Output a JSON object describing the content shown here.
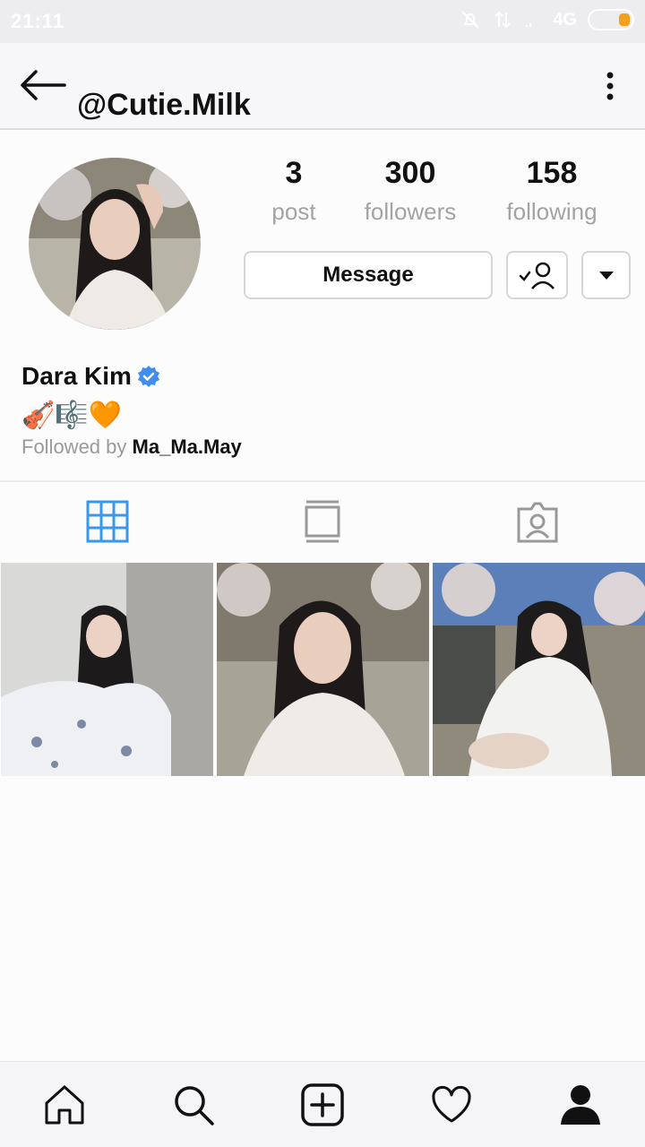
{
  "status": {
    "time": "21:11",
    "network": "4G"
  },
  "header": {
    "username": "@Cutie.Milk"
  },
  "profile": {
    "stats": [
      {
        "value": "3",
        "label": "post"
      },
      {
        "value": "300",
        "label": "followers"
      },
      {
        "value": "158",
        "label": "following"
      }
    ],
    "message_label": "Message",
    "display_name": "Dara Kim",
    "bio": "🎻🎼🧡",
    "followed_by_prefix": "Followed by",
    "followed_by_user": "Ma_Ma.May"
  },
  "colors": {
    "accent": "#3897f0",
    "verified": "#3d8ef0",
    "muted": "#a3a3a3"
  }
}
